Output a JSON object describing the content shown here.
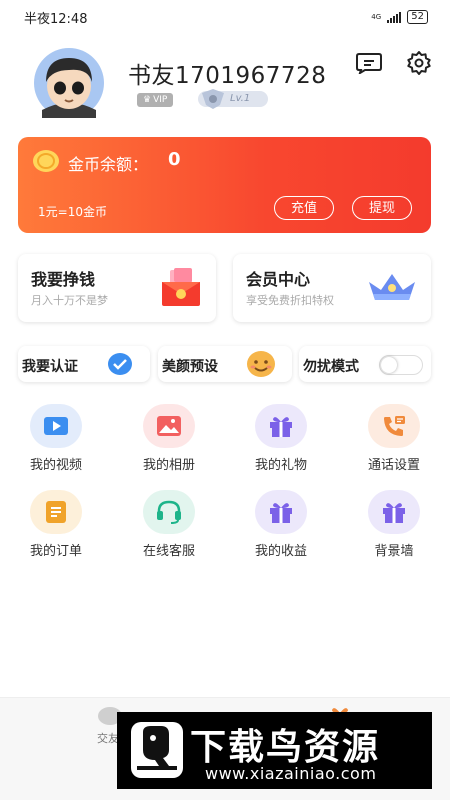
{
  "status_bar": {
    "time": "半夜12:48",
    "network": "4G",
    "battery": "52"
  },
  "profile": {
    "username": "书友1701967728",
    "vip": "VIP",
    "level": "Lv.1"
  },
  "wallet": {
    "balance_label": "金币余额：",
    "balance_value": "0",
    "rate": "1元=10金币",
    "recharge": "充值",
    "withdraw": "提现"
  },
  "promos": [
    {
      "title": "我要挣钱",
      "subtitle": "月入十万不是梦"
    },
    {
      "title": "会员中心",
      "subtitle": "享受免费折扣特权"
    }
  ],
  "quick": {
    "verify": "我要认证",
    "beauty": "美颜预设",
    "dnd": "勿扰模式",
    "dnd_on": false
  },
  "menu": [
    {
      "label": "我的视频",
      "icon": "video-icon",
      "bg": "#e3ecfb"
    },
    {
      "label": "我的相册",
      "icon": "photo-icon",
      "bg": "#fde6e6"
    },
    {
      "label": "我的礼物",
      "icon": "gift-icon",
      "bg": "#ece8fb"
    },
    {
      "label": "通话设置",
      "icon": "phone-icon",
      "bg": "#fdebe0"
    },
    {
      "label": "我的订单",
      "icon": "order-icon",
      "bg": "#fdf0da"
    },
    {
      "label": "在线客服",
      "icon": "headset-icon",
      "bg": "#e2f5ee"
    },
    {
      "label": "我的收益",
      "icon": "gift-icon",
      "bg": "#ece8fb"
    },
    {
      "label": "背景墙",
      "icon": "gift-icon",
      "bg": "#ece8fb"
    }
  ],
  "tabbar": {
    "left_label": "交友"
  },
  "watermark": {
    "title": "下载鸟资源",
    "url": "www.xiazainiao.com"
  },
  "colors": {
    "accent": "#f8472f",
    "blue": "#3b8ef0",
    "purple": "#7b61e8",
    "orange": "#f08a3c",
    "green": "#1db48a",
    "yellow": "#f0a32a"
  }
}
